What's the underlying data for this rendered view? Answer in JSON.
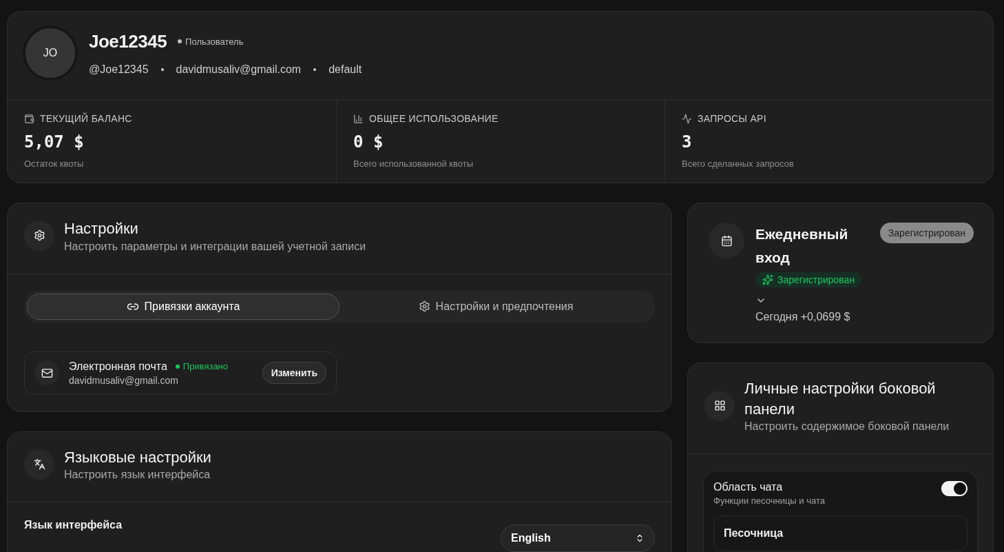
{
  "profile": {
    "initials": "JO",
    "name": "Joe12345",
    "role": "Пользователь",
    "handle": "@Joe12345",
    "email": "davidmusaliv@gmail.com",
    "group": "default"
  },
  "stats": [
    {
      "kind": "balance",
      "label": "ТЕКУЩИЙ БАЛАНС",
      "value": "5,07 $",
      "note": "Остаток квоты"
    },
    {
      "kind": "usage",
      "label": "ОБЩЕЕ ИСПОЛЬЗОВАНИЕ",
      "value": "0 $",
      "note": "Всего использованной квоты"
    },
    {
      "kind": "requests",
      "label": "ЗАПРОСЫ API",
      "value": "3",
      "note": "Всего сделанных запросов"
    }
  ],
  "settings": {
    "title": "Настройки",
    "subtitle": "Настроить параметры и интеграции вашей учетной записи",
    "tabs": [
      {
        "kind": "link",
        "label": "Привязки аккаунта",
        "selected": true
      },
      {
        "kind": "gear",
        "label": "Настройки и предпочтения",
        "selected": false
      }
    ],
    "bindings": [
      {
        "kind": "mail",
        "label": "Электронная почта",
        "status": "Привязано",
        "value": "davidmusaliv@gmail.com",
        "action": "Изменить"
      }
    ]
  },
  "language": {
    "title": "Языковые настройки",
    "subtitle": "Настроить язык интерфейса",
    "field_label": "Язык интерфейса",
    "select_value": "English"
  },
  "checkin": {
    "title": "Ежедневный вход",
    "badge": "Зарегистрирован",
    "status": "Зарегистрирован",
    "expanded": false,
    "today": "Сегодня +0,0699 $"
  },
  "sidebar": {
    "title": "Личные настройки боковой панели",
    "subtitle": "Настроить содержимое боковой панели",
    "sections": [
      {
        "label": "Область чата",
        "description": "Функции песочницы и чата",
        "on": true,
        "items": [
          "Песочница"
        ]
      }
    ]
  }
}
